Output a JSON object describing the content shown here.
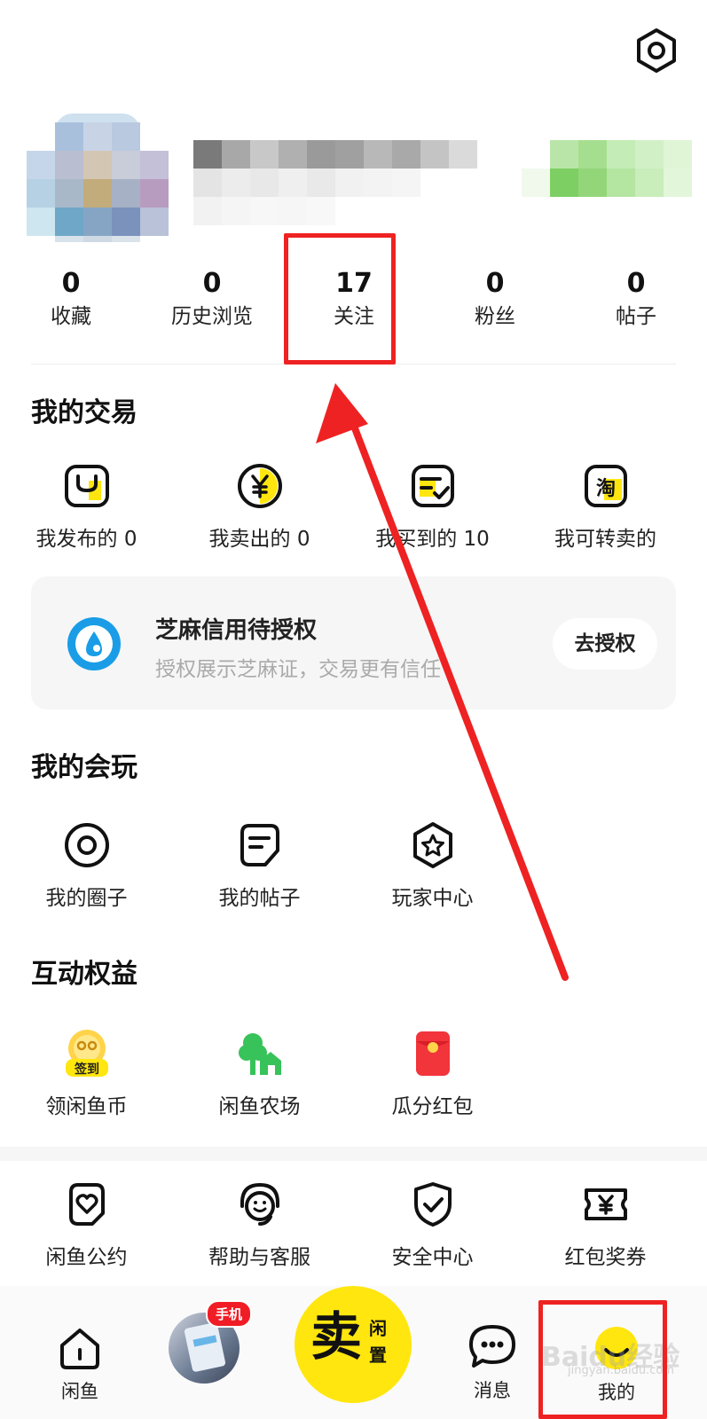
{
  "stats": [
    {
      "value": "0",
      "label": "收藏"
    },
    {
      "value": "0",
      "label": "历史浏览"
    },
    {
      "value": "17",
      "label": "关注"
    },
    {
      "value": "0",
      "label": "粉丝"
    },
    {
      "value": "0",
      "label": "帖子"
    }
  ],
  "trade": {
    "title": "我的交易",
    "items": [
      {
        "label": "我发布的 0",
        "icon": "bag-icon"
      },
      {
        "label": "我卖出的 0",
        "icon": "yen-coin-icon"
      },
      {
        "label": "我买到的 10",
        "icon": "receipt-check-icon"
      },
      {
        "label": "我可转卖的",
        "icon": "taobao-icon"
      }
    ]
  },
  "credit": {
    "title": "芝麻信用待授权",
    "subtitle": "授权展示芝麻证，交易更有信任",
    "button": "去授权"
  },
  "play": {
    "title": "我的会玩",
    "items": [
      {
        "label": "我的圈子",
        "icon": "circle-icon"
      },
      {
        "label": "我的帖子",
        "icon": "post-icon"
      },
      {
        "label": "玩家中心",
        "icon": "star-badge-icon"
      }
    ]
  },
  "rights": {
    "title": "互动权益",
    "items": [
      {
        "label": "领闲鱼币",
        "icon": "sign-in-icon",
        "badge": "签到"
      },
      {
        "label": "闲鱼农场",
        "icon": "farm-tree-icon"
      },
      {
        "label": "瓜分红包",
        "icon": "red-envelope-icon"
      }
    ]
  },
  "services": [
    {
      "label": "闲鱼公约",
      "icon": "heart-doc-icon"
    },
    {
      "label": "帮助与客服",
      "icon": "headset-icon"
    },
    {
      "label": "安全中心",
      "icon": "shield-check-icon"
    },
    {
      "label": "红包奖券",
      "icon": "yen-ticket-icon"
    }
  ],
  "tabbar": {
    "home": "闲鱼",
    "promo_badge": "手机",
    "sell_main": "卖",
    "sell_sub1": "闲",
    "sell_sub2": "置",
    "messages": "消息",
    "mine": "我的"
  },
  "watermark": {
    "main": "Baidu经验",
    "sub": "jingyan.baidu.com"
  },
  "colors": {
    "accent_yellow": "#ffe60f",
    "highlight_red": "#ee2222",
    "alipay_blue": "#1a9de6"
  }
}
